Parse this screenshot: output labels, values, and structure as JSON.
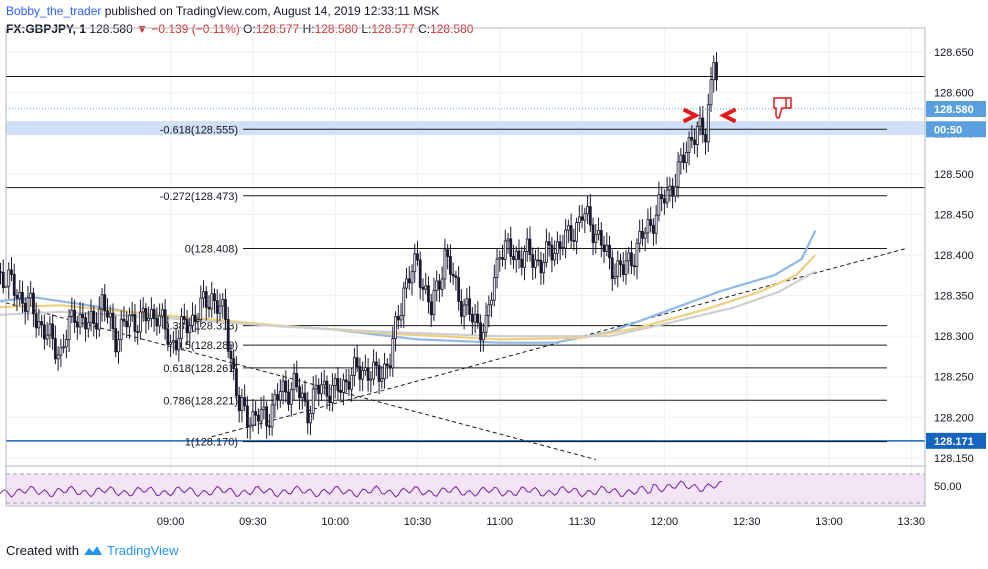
{
  "header": {
    "author": "Bobby_the_trader",
    "published_text": "published on TradingView.com, August 14, 2019 12:33:11 MSK",
    "symbol": "FX:GBPJPY, 1",
    "last": "128.580",
    "change": "▼ −0.139 (−0.11%)",
    "o_label": "O:",
    "o": "128.577",
    "h_label": "H:",
    "h": "128.580",
    "l_label": "L:",
    "l": "128.577",
    "c_label": "C:",
    "c": "128.580"
  },
  "footer": {
    "created_with": "Created with",
    "brand": "TradingView"
  },
  "colors": {
    "candle": "#1a1a2e",
    "ma_blue": "#90b8e8",
    "ma_yellow": "#f0d080",
    "ma_grey": "#cfcfcf",
    "highlight_band": "#cfe0f7",
    "level_blue": "#1565c0",
    "last_price_bg": "#5aa0e0",
    "rsi_line": "#7b1fa2",
    "rsi_band": "#f3e5f5",
    "arrow": "#e21a1a"
  },
  "chart_data": {
    "type": "candlestick",
    "interval": "1 minute",
    "y_axis": {
      "range": [
        128.14,
        128.665
      ],
      "ticks": [
        "128.650",
        "128.600",
        "128.550",
        "128.500",
        "128.450",
        "128.400",
        "128.350",
        "128.300",
        "128.250",
        "128.200",
        "128.150"
      ],
      "labels": [
        {
          "value": 128.58,
          "text": "128.580",
          "kind": "last-price"
        },
        {
          "value": 128.555,
          "text": "00:50",
          "kind": "countdown"
        },
        {
          "value": 128.171,
          "text": "128.171",
          "kind": "horizontal-line"
        }
      ]
    },
    "x_axis": {
      "ticks": [
        "09:00",
        "09:30",
        "10:00",
        "10:30",
        "11:00",
        "11:30",
        "12:00",
        "12:30",
        "13:00",
        "13:30"
      ],
      "range_minutes": [
        480,
        815
      ]
    },
    "fib_levels": [
      {
        "ratio": "-0.618",
        "price": 128.555,
        "label": "-0.618(128.555)"
      },
      {
        "ratio": "-0.272",
        "price": 128.473,
        "label": "-0.272(128.473)"
      },
      {
        "ratio": "0",
        "price": 128.408,
        "label": "0(128.408)"
      },
      {
        "ratio": "0.382",
        "price": 128.313,
        "label": "0.382(128.313)"
      },
      {
        "ratio": "0.5",
        "price": 128.289,
        "label": "0.5(128.289)"
      },
      {
        "ratio": "0.618",
        "price": 128.261,
        "label": "0.618(128.261)"
      },
      {
        "ratio": "0.786",
        "price": 128.221,
        "label": "0.786(128.221)"
      },
      {
        "ratio": "1",
        "price": 128.17,
        "label": "1(128.170)"
      }
    ],
    "extra_levels": [
      128.62,
      128.483,
      128.171
    ],
    "highlight_zone": [
      128.548,
      128.565
    ],
    "trendlines": [
      {
        "style": "dashed",
        "from": {
          "time": 555,
          "price": 128.176
        },
        "to": {
          "time": 808,
          "price": 128.408
        }
      },
      {
        "style": "dashed",
        "from": {
          "time": 470,
          "price": 128.35
        },
        "to": {
          "time": 695,
          "price": 128.148
        }
      }
    ],
    "moving_averages": [
      {
        "color": "blue",
        "points": [
          [
            470,
            128.34
          ],
          [
            490,
            128.348
          ],
          [
            510,
            128.338
          ],
          [
            540,
            128.322
          ],
          [
            570,
            128.315
          ],
          [
            600,
            128.308
          ],
          [
            630,
            128.296
          ],
          [
            660,
            128.292
          ],
          [
            680,
            128.292
          ],
          [
            700,
            128.305
          ],
          [
            720,
            128.33
          ],
          [
            740,
            128.355
          ],
          [
            760,
            128.375
          ],
          [
            770,
            128.395
          ],
          [
            775,
            128.43
          ]
        ]
      },
      {
        "color": "yellow",
        "points": [
          [
            470,
            128.335
          ],
          [
            500,
            128.338
          ],
          [
            540,
            128.325
          ],
          [
            580,
            128.313
          ],
          [
            620,
            128.303
          ],
          [
            660,
            128.296
          ],
          [
            690,
            128.298
          ],
          [
            710,
            128.31
          ],
          [
            735,
            128.333
          ],
          [
            755,
            128.355
          ],
          [
            768,
            128.375
          ],
          [
            775,
            128.4
          ]
        ]
      },
      {
        "color": "grey",
        "points": [
          [
            470,
            128.325
          ],
          [
            500,
            128.33
          ],
          [
            540,
            128.322
          ],
          [
            580,
            128.312
          ],
          [
            620,
            128.305
          ],
          [
            660,
            128.3
          ],
          [
            700,
            128.3
          ],
          [
            720,
            128.315
          ],
          [
            745,
            128.335
          ],
          [
            762,
            128.355
          ],
          [
            775,
            128.38
          ]
        ]
      }
    ],
    "candles": [
      {
        "t": 470,
        "c": 128.4
      },
      {
        "t": 480,
        "c": 128.37
      },
      {
        "t": 490,
        "c": 128.33
      },
      {
        "t": 495,
        "c": 128.3
      },
      {
        "t": 500,
        "c": 128.28
      },
      {
        "t": 505,
        "c": 128.33
      },
      {
        "t": 510,
        "c": 128.31
      },
      {
        "t": 515,
        "c": 128.34
      },
      {
        "t": 520,
        "c": 128.3
      },
      {
        "t": 525,
        "c": 128.32
      },
      {
        "t": 530,
        "c": 128.32
      },
      {
        "t": 535,
        "c": 128.33
      },
      {
        "t": 540,
        "c": 128.29
      },
      {
        "t": 545,
        "c": 128.31
      },
      {
        "t": 550,
        "c": 128.33
      },
      {
        "t": 555,
        "c": 128.35
      },
      {
        "t": 560,
        "c": 128.32
      },
      {
        "t": 565,
        "c": 128.21
      },
      {
        "t": 570,
        "c": 128.2
      },
      {
        "t": 575,
        "c": 128.2
      },
      {
        "t": 580,
        "c": 128.23
      },
      {
        "t": 585,
        "c": 128.24
      },
      {
        "t": 590,
        "c": 128.21
      },
      {
        "t": 595,
        "c": 128.24
      },
      {
        "t": 600,
        "c": 128.23
      },
      {
        "t": 605,
        "c": 128.25
      },
      {
        "t": 610,
        "c": 128.26
      },
      {
        "t": 615,
        "c": 128.25
      },
      {
        "t": 620,
        "c": 128.27
      },
      {
        "t": 625,
        "c": 128.36
      },
      {
        "t": 630,
        "c": 128.39
      },
      {
        "t": 635,
        "c": 128.33
      },
      {
        "t": 640,
        "c": 128.4
      },
      {
        "t": 645,
        "c": 128.35
      },
      {
        "t": 650,
        "c": 128.32
      },
      {
        "t": 655,
        "c": 128.31
      },
      {
        "t": 660,
        "c": 128.41
      },
      {
        "t": 665,
        "c": 128.4
      },
      {
        "t": 670,
        "c": 128.4
      },
      {
        "t": 675,
        "c": 128.39
      },
      {
        "t": 680,
        "c": 128.41
      },
      {
        "t": 685,
        "c": 128.42
      },
      {
        "t": 690,
        "c": 128.45
      },
      {
        "t": 695,
        "c": 128.43
      },
      {
        "t": 700,
        "c": 128.39
      },
      {
        "t": 705,
        "c": 128.38
      },
      {
        "t": 710,
        "c": 128.41
      },
      {
        "t": 715,
        "c": 128.44
      },
      {
        "t": 720,
        "c": 128.47
      },
      {
        "t": 725,
        "c": 128.5
      },
      {
        "t": 730,
        "c": 128.55
      },
      {
        "t": 735,
        "c": 128.55
      },
      {
        "t": 738,
        "c": 128.65
      },
      {
        "t": 740,
        "c": 128.58
      }
    ],
    "rsi": {
      "reference_level": "50.00",
      "upper_band": 70,
      "lower_band": 30
    }
  }
}
